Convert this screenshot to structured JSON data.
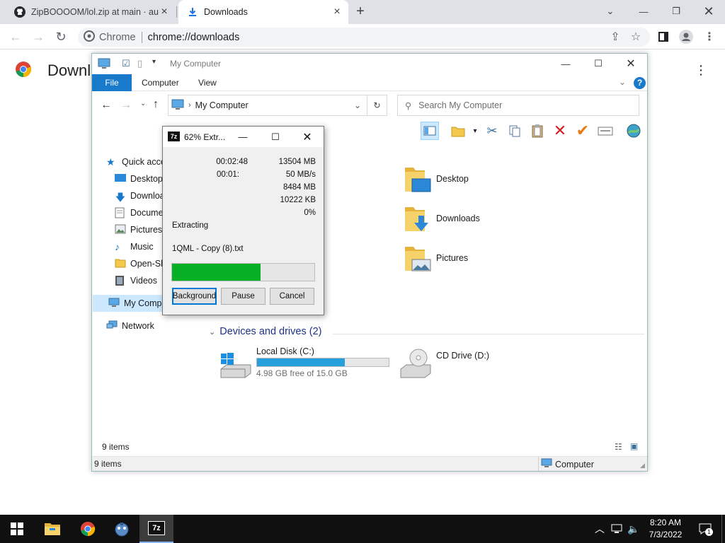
{
  "browser": {
    "tabs": [
      {
        "title": "ZipBOOOOM/lol.zip at main · au",
        "icon": "github-icon"
      },
      {
        "title": "Downloads",
        "icon": "download-icon",
        "active": true
      }
    ],
    "site_chip": "Chrome",
    "url": "chrome://downloads",
    "page_title": "Downloads"
  },
  "explorer": {
    "title": "My Computer",
    "ribbon_tabs": [
      "File",
      "Computer",
      "View"
    ],
    "address": "My Computer",
    "search_placeholder": "Search My Computer",
    "nav_items": [
      "Quick access",
      "Desktop",
      "Downloads",
      "Documents",
      "Pictures",
      "Music",
      "Open-Shell",
      "Videos",
      "My Computer",
      "Network"
    ],
    "folders": [
      "Desktop",
      "Downloads",
      "Pictures"
    ],
    "devices_header": "Devices and drives (2)",
    "drives": [
      {
        "name": "Local Disk (C:)",
        "free_text": "4.98 GB free of 15.0 GB",
        "used_fraction": 0.668
      },
      {
        "name": "CD Drive (D:)"
      }
    ],
    "status_items": "9 items",
    "status_location": "Computer"
  },
  "sevenzip": {
    "title": "62% Extr...",
    "elapsed": "00:02:48",
    "remaining": "00:01:",
    "total_size": "13504 MB",
    "speed": "50 MB/s",
    "processed": "8484 MB",
    "compressed": "10222 KB",
    "ratio": "0%",
    "status": "Extracting",
    "current_file": "1QML - Copy (8).txt",
    "progress": 0.62,
    "buttons": {
      "background": "Background",
      "pause": "Pause",
      "cancel": "Cancel"
    }
  },
  "taskbar": {
    "apps": [
      "file-explorer-icon",
      "chrome-icon",
      "app-icon",
      "7zip-icon"
    ],
    "time": "8:20 AM",
    "date": "7/3/2022",
    "notification_count": "1"
  },
  "colors": {
    "ribbon_file": "#1979ca",
    "progress": "#06b025",
    "drive_bar": "#26a0da",
    "taskbar": "#101010"
  }
}
